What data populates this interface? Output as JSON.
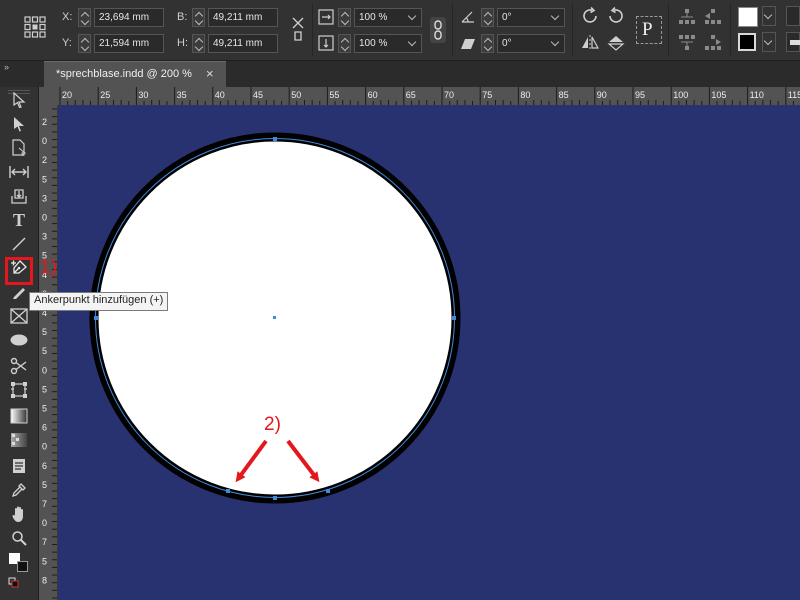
{
  "control_bar": {
    "x_label": "X:",
    "x_value": "23,694 mm",
    "y_label": "Y:",
    "y_value": "21,594 mm",
    "w_label": "B:",
    "w_value": "49,211 mm",
    "h_label": "H:",
    "h_value": "49,211 mm",
    "scale_x": "100 %",
    "scale_y": "100 %",
    "rotate": "0°",
    "shear": "0°",
    "p_glyph": "P"
  },
  "tab": {
    "title": "*sprechblase.indd @ 200 %",
    "close": "×"
  },
  "ruler_top": [
    "20",
    "25",
    "30",
    "35",
    "40",
    "45",
    "50",
    "55",
    "60",
    "65",
    "70",
    "75",
    "80",
    "85",
    "90",
    "95",
    "100",
    "105",
    "110",
    "115"
  ],
  "ruler_left": [
    "2",
    "0",
    "2",
    "5",
    "3",
    "0",
    "3",
    "5",
    "4",
    "0",
    "4",
    "5",
    "5",
    "0",
    "5",
    "5",
    "6",
    "0",
    "6",
    "5",
    "7",
    "0",
    "7",
    "5",
    "8"
  ],
  "tooltip": "Ankerpunkt hinzufügen (+)",
  "annotations": {
    "one": "1)",
    "two": "2)"
  },
  "colors": {
    "canvas": "#283270",
    "annotation": "#e4161e",
    "path": "#3f8bd9"
  }
}
